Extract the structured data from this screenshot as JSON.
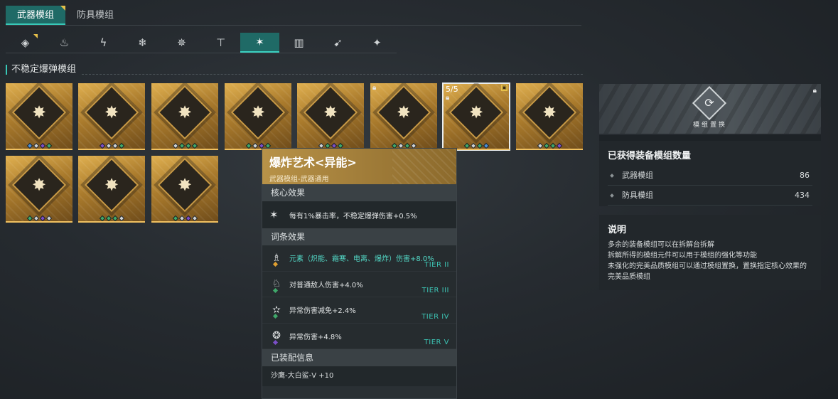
{
  "tabs": [
    {
      "label": "武器模组",
      "active": true
    },
    {
      "label": "防具模组",
      "active": false
    }
  ],
  "element_tabs": [
    {
      "icon": "all-icon",
      "glyph": "◈"
    },
    {
      "icon": "fire-icon",
      "glyph": "♨"
    },
    {
      "icon": "lightning-icon",
      "glyph": "ϟ"
    },
    {
      "icon": "frost-icon",
      "glyph": "❄"
    },
    {
      "icon": "disperse-icon",
      "glyph": "✵"
    },
    {
      "icon": "anvil-icon",
      "glyph": "⊤"
    },
    {
      "icon": "explosive-icon",
      "glyph": "✶"
    },
    {
      "icon": "ammo-icon",
      "glyph": "▥"
    },
    {
      "icon": "arrow-icon",
      "glyph": "➹"
    },
    {
      "icon": "wrench-icon",
      "glyph": "✦"
    }
  ],
  "section_title": "不稳定爆弹模组",
  "modules": [
    {
      "glyph": "✸",
      "dots": [
        "#4a8fd8",
        "#cfd3d5",
        "#7b4fc8",
        "#3fa86a"
      ]
    },
    {
      "glyph": "✸",
      "dots": [
        "#7b4fc8",
        "#cfd3d5",
        "#cfd3d5",
        "#3fa86a"
      ]
    },
    {
      "glyph": "✸",
      "dots": [
        "#cfd3d5",
        "#3fa86a",
        "#3fa86a",
        "#3fa86a"
      ]
    },
    {
      "glyph": "✸",
      "dots": [
        "#3fa86a",
        "#cfd3d5",
        "#7b4fc8",
        "#3fa86a"
      ]
    },
    {
      "glyph": "✸",
      "dots": [
        "#cfd3d5",
        "#3fa86a",
        "#7b4fc8",
        "#3fa86a"
      ]
    },
    {
      "glyph": "✸",
      "dots": [
        "#3fa86a",
        "#cfd3d5",
        "#3fa86a",
        "#cfd3d5"
      ]
    },
    {
      "glyph": "✸",
      "dots": [
        "#3fa86a",
        "#cfd3d5",
        "#3fa86a",
        "#4a8fd8"
      ]
    },
    {
      "glyph": "✸",
      "dots": [
        "#cfd3d5",
        "#3fa86a",
        "#3fa86a",
        "#7b4fc8"
      ]
    },
    {
      "glyph": "✸",
      "dots": [
        "#3fa86a",
        "#cfd3d5",
        "#7b4fc8",
        "#cfd3d5"
      ]
    },
    {
      "glyph": "✸",
      "dots": [
        "#3fa86a",
        "#3fa86a",
        "#3fa86a",
        "#cfd3d5"
      ]
    },
    {
      "glyph": "✸",
      "dots": [
        "#3fa86a",
        "#cfd3d5",
        "#7b4fc8",
        "#cfd3d5"
      ]
    }
  ],
  "selected_count": "5/5",
  "tooltip": {
    "title": "爆炸艺术<异能>",
    "subtitle": "武器模组-武器通用",
    "core_heading": "核心效果",
    "core_effect": "每有1%暴击率，不稳定爆弹伤害+0.5%",
    "affix_heading": "词条效果",
    "affixes": [
      {
        "text": "元素（炽能、霜寒、电离、爆炸）伤害+8.0%",
        "tier": "TIER II",
        "gem": "#e0a030",
        "highlight": true,
        "icon": "flask-icon",
        "glyph": "♗"
      },
      {
        "text": "对普通敌人伤害+4.0%",
        "tier": "TIER III",
        "gem": "#3fa86a",
        "highlight": false,
        "icon": "enemy-icon",
        "glyph": "♘"
      },
      {
        "text": "异常伤害减免+2.4%",
        "tier": "TIER IV",
        "gem": "#3fa86a",
        "highlight": false,
        "icon": "star-icon",
        "glyph": "✫"
      },
      {
        "text": "异常伤害+4.8%",
        "tier": "TIER V",
        "gem": "#7b4fc8",
        "highlight": false,
        "icon": "burst-icon",
        "glyph": "❂"
      }
    ],
    "equip_heading": "已装配信息",
    "equip_info": "沙鹰-大白鲨-V +10"
  },
  "right_panel": {
    "banner_caption": "模组置换",
    "stats_title": "已获得装备模组数量",
    "weapon_label": "武器模组",
    "weapon_count": "86",
    "armor_label": "防具模组",
    "armor_count": "434",
    "desc_title": "说明",
    "desc_lines": [
      "多余的装备模组可以在拆解台拆解",
      "拆解所得的模组元件可以用于模组的强化等功能",
      "未强化的完美品质模组可以通过模组置换，置换指定核心效果的",
      "完美品质模组"
    ]
  },
  "colors": {
    "accent": "#1f6a66",
    "accent_line": "#38c8b8",
    "gold": "#c99a45",
    "tier": "#3cc4b4"
  }
}
